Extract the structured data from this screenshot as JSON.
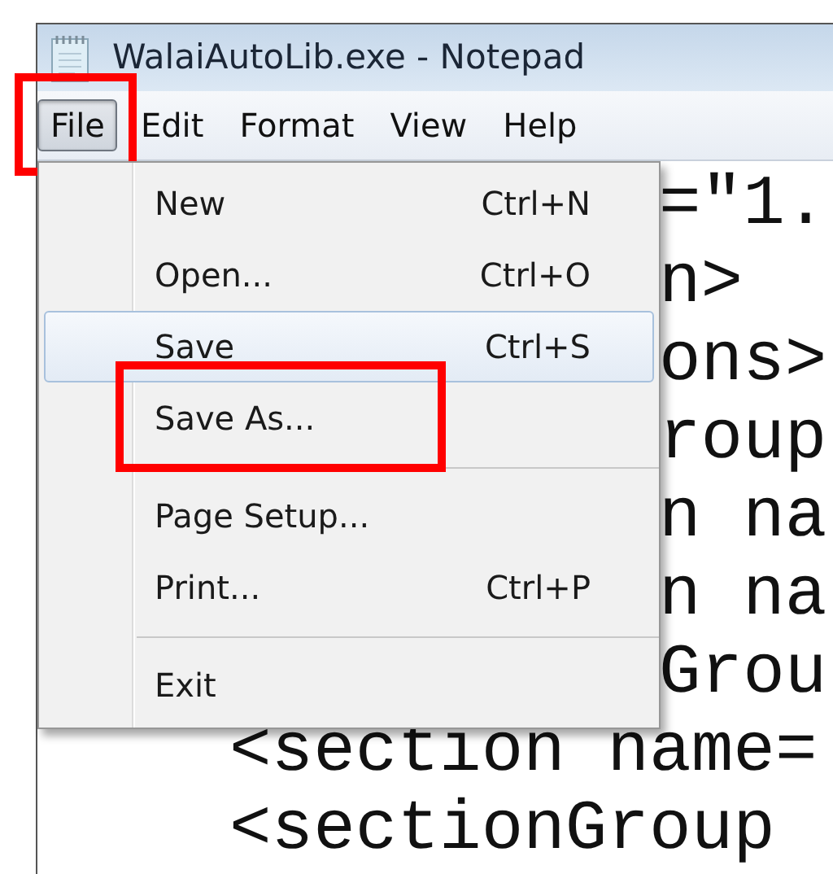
{
  "window": {
    "title": "WalaiAutoLib.exe - Notepad"
  },
  "menu_bar": [
    {
      "label": "File",
      "selected": true,
      "highlighted": true
    },
    {
      "label": "Edit",
      "selected": false,
      "highlighted": false
    },
    {
      "label": "Format",
      "selected": false,
      "highlighted": false
    },
    {
      "label": "View",
      "selected": false,
      "highlighted": false
    },
    {
      "label": "Help",
      "selected": false,
      "highlighted": false
    }
  ],
  "file_menu": {
    "items": [
      {
        "kind": "item",
        "label": "New",
        "shortcut": "Ctrl+N",
        "selected": false,
        "highlighted": false
      },
      {
        "kind": "item",
        "label": "Open...",
        "shortcut": "Ctrl+O",
        "selected": false,
        "highlighted": false
      },
      {
        "kind": "item",
        "label": "Save",
        "shortcut": "Ctrl+S",
        "selected": true,
        "highlighted": false
      },
      {
        "kind": "item",
        "label": "Save As...",
        "selected": false,
        "highlighted": true
      },
      {
        "kind": "separator"
      },
      {
        "kind": "item",
        "label": "Page Setup...",
        "selected": false,
        "highlighted": false
      },
      {
        "kind": "item",
        "label": "Print...",
        "shortcut": "Ctrl+P",
        "selected": false,
        "highlighted": false
      },
      {
        "kind": "separator"
      },
      {
        "kind": "item",
        "label": "Exit",
        "selected": false,
        "highlighted": false
      }
    ]
  },
  "editor": {
    "lines": [
      {
        "kind": "partial",
        "text": "=\"1."
      },
      {
        "kind": "partial",
        "text": "n>"
      },
      {
        "kind": "partial",
        "text": "ons>"
      },
      {
        "kind": "partial",
        "text": "roup"
      },
      {
        "kind": "partial",
        "text": "n na"
      },
      {
        "kind": "partial",
        "text": "n na"
      },
      {
        "kind": "partial",
        "text": "Grou"
      },
      {
        "kind": "full",
        "text": "<section name="
      },
      {
        "kind": "full",
        "text": "<sectionGroup"
      }
    ]
  }
}
